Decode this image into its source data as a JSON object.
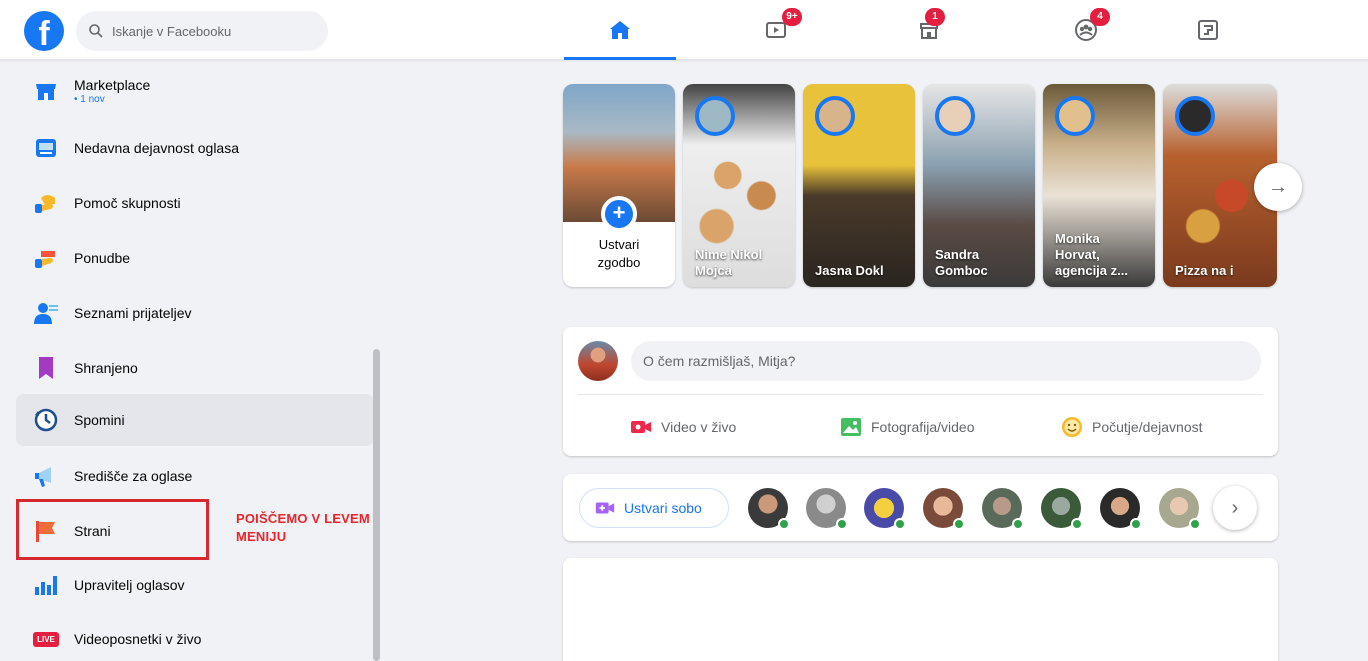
{
  "search": {
    "placeholder": "Iskanje v Facebooku"
  },
  "nav": {
    "tabs": [
      {
        "name": "home",
        "badge": ""
      },
      {
        "name": "watch",
        "badge": "9+"
      },
      {
        "name": "marketplace",
        "badge": "1"
      },
      {
        "name": "groups",
        "badge": "4"
      },
      {
        "name": "gaming",
        "badge": ""
      }
    ]
  },
  "sidebar": {
    "items": [
      {
        "label": "Marketplace",
        "sub": "• 1 nov"
      },
      {
        "label": "Nedavna dejavnost oglasa"
      },
      {
        "label": "Pomoč skupnosti"
      },
      {
        "label": "Ponudbe"
      },
      {
        "label": "Seznami prijateljev"
      },
      {
        "label": "Shranjeno"
      },
      {
        "label": "Spomini"
      },
      {
        "label": "Središče za oglase"
      },
      {
        "label": "Strani"
      },
      {
        "label": "Upravitelj oglasov"
      },
      {
        "label": "Videoposnetki v živo",
        "icon_text": "LIVE"
      }
    ],
    "annotation": {
      "line1": "POIŠČEMO V LEVEM",
      "line2": "MENIJU"
    }
  },
  "stories": {
    "create_label_1": "Ustvari",
    "create_label_2": "zgodbo",
    "items": [
      {
        "name_1": "Nime Nikol",
        "name_2": "Mojca"
      },
      {
        "name_1": "Jasna Dokl",
        "name_2": ""
      },
      {
        "name_1": "Sandra",
        "name_2": "Gomboc"
      },
      {
        "name_1": "Monika",
        "name_2": "Horvat,",
        "name_3": "agencija z..."
      },
      {
        "name_1": "Pizza na i",
        "name_2": ""
      }
    ]
  },
  "composer": {
    "placeholder": "O čem razmišljaš, Mitja?",
    "actions": {
      "live": "Video v živo",
      "photo": "Fotografija/video",
      "feeling": "Počutje/dejavnost"
    }
  },
  "rooms": {
    "create_label": "Ustvari sobo"
  },
  "colors": {
    "brand": "#1877f2",
    "badge": "#e41e3f",
    "annotation": "#e8262d",
    "online": "#31a24c"
  }
}
